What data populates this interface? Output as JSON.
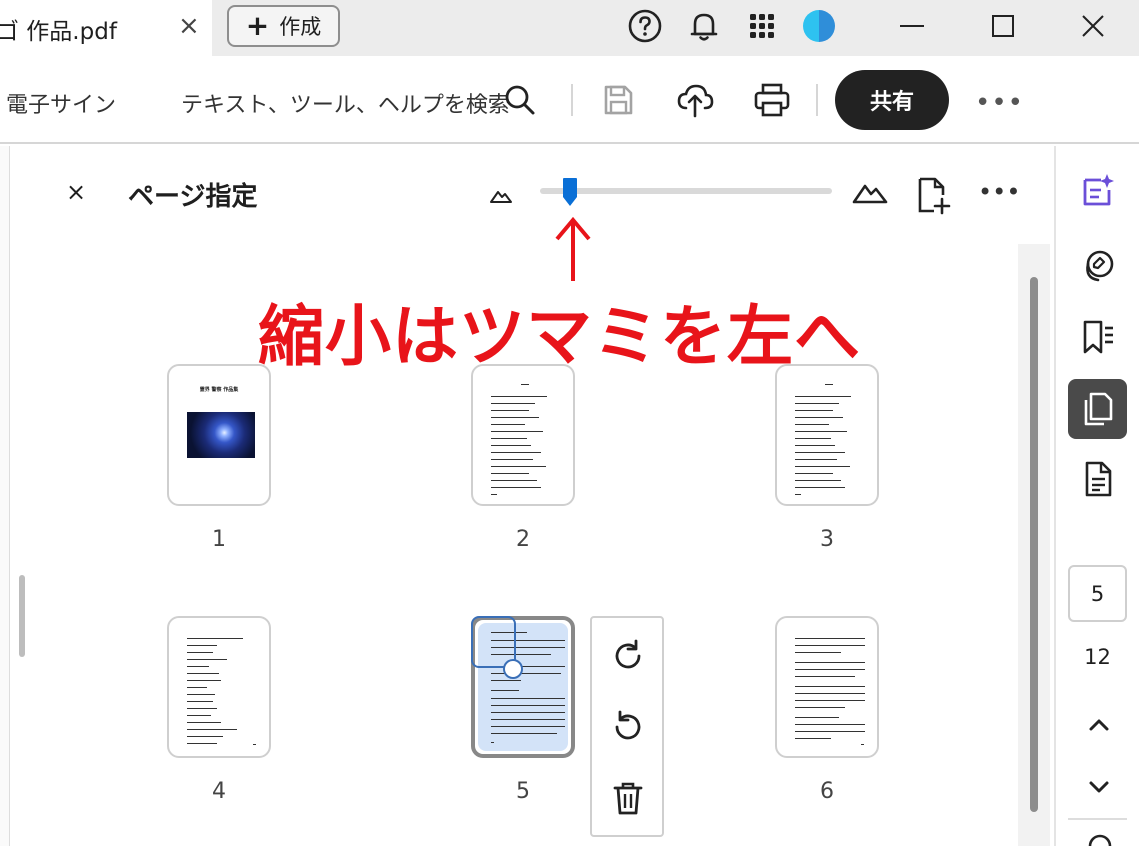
{
  "titlebar": {
    "doc_title": "ゴ 作品.pdf",
    "close_tab": "×",
    "create_label": "作成",
    "create_plus": "+"
  },
  "toolbar": {
    "esign_label": "電子サイン",
    "search_label": "テキスト、ツール、ヘルプを検索",
    "share_label": "共有",
    "more": "•••"
  },
  "panel": {
    "close": "×",
    "title": "ページ指定",
    "more": "•••",
    "zoom_level": 0.11
  },
  "annotation": {
    "text": "縮小はツマミを左へ",
    "color": "#e8141a"
  },
  "thumbnails": [
    {
      "page": "1",
      "cover_title": "霊界 警察 作品集"
    },
    {
      "page": "2"
    },
    {
      "page": "3"
    },
    {
      "page": "4"
    },
    {
      "page": "5",
      "selected": true
    },
    {
      "page": "6"
    }
  ],
  "rail": {
    "current_page": "5",
    "total_pages": "12"
  },
  "colors": {
    "accent_blue": "#0a6fd6",
    "share_bg": "#222222",
    "ai_purple": "#6b4fd8"
  }
}
